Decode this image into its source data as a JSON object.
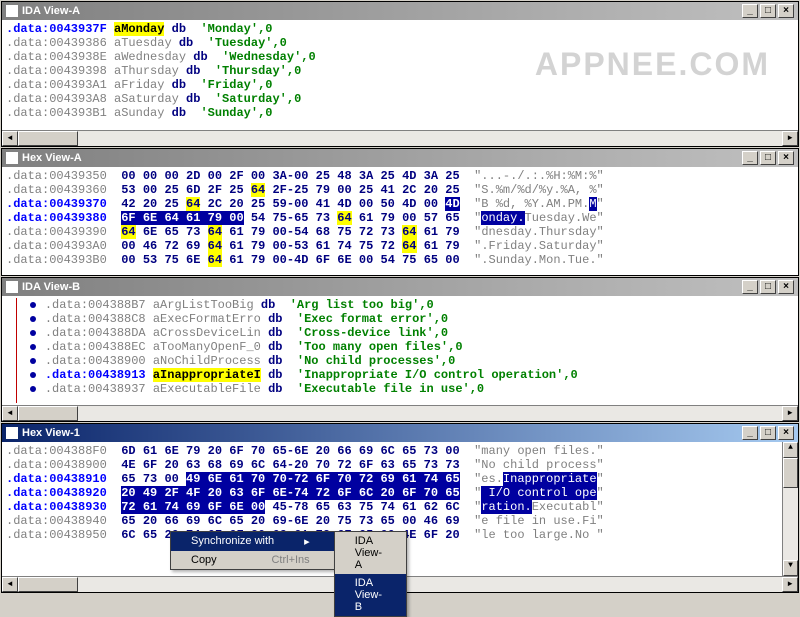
{
  "watermark": "APPNEE.COM",
  "windows": {
    "ida_a": {
      "title": "IDA View-A"
    },
    "hex_a": {
      "title": "Hex View-A"
    },
    "ida_b": {
      "title": "IDA View-B"
    },
    "hex_1": {
      "title": "Hex View-1"
    }
  },
  "ida_a_lines": [
    {
      "addr": ".data:0043937F",
      "bold": true,
      "label": "aMonday",
      "hl": true,
      "rest": " db  'Monday',0"
    },
    {
      "addr": ".data:00439386",
      "bold": false,
      "label": "aTuesday",
      "hl": false,
      "rest": " db  'Tuesday',0"
    },
    {
      "addr": ".data:0043938E",
      "bold": false,
      "label": "aWednesday",
      "hl": false,
      "rest": " db  'Wednesday',0"
    },
    {
      "addr": ".data:00439398",
      "bold": false,
      "label": "aThursday",
      "hl": false,
      "rest": " db  'Thursday',0"
    },
    {
      "addr": ".data:004393A1",
      "bold": false,
      "label": "aFriday",
      "hl": false,
      "rest": " db  'Friday',0"
    },
    {
      "addr": ".data:004393A8",
      "bold": false,
      "label": "aSaturday",
      "hl": false,
      "rest": " db  'Saturday',0"
    },
    {
      "addr": ".data:004393B1",
      "bold": false,
      "label": "aSunday",
      "hl": false,
      "rest": " db  'Sunday',0"
    }
  ],
  "hex_a_lines": [
    {
      "addr": ".data:00439350",
      "hex": "00 00 00 2D 00 2F 00 3A-00 25 48 3A 25 4D 3A 25",
      "ascii": "\"...-./.:.%H:%M:%\""
    },
    {
      "addr": ".data:00439360",
      "hex": "53 00 25 6D 2F 25 64 2F-25 79 00 25 41 2C 20 25",
      "ascii": "\"S.%m/%d/%y.%A, %\""
    },
    {
      "addr": ".data:00439370",
      "hex": "42 20 25 64 2C 20 25 59-00 41 4D 00 50 4D 00 4D",
      "ascii": "\"B %d, %Y.AM.PM.M\""
    },
    {
      "addr": ".data:00439380",
      "hex": "6F 6E 64 61 79 00 54 75-65 73 64 61 79 00 57 65",
      "ascii": "\"onday.Tuesday.We\""
    },
    {
      "addr": ".data:00439390",
      "hex": "64 6E 65 73 64 61 79 00-54 68 75 72 73 64 61 79",
      "ascii": "\"dnesday.Thursday\""
    },
    {
      "addr": ".data:004393A0",
      "hex": "00 46 72 69 64 61 79 00-53 61 74 75 72 64 61 79",
      "ascii": "\".Friday.Saturday\""
    },
    {
      "addr": ".data:004393B0",
      "hex": "00 53 75 6E 64 61 79 00-4D 6F 6E 00 54 75 65 00",
      "ascii": "\".Sunday.Mon.Tue.\""
    }
  ],
  "ida_b_lines": [
    {
      "addr": ".data:004388B7",
      "label": "aArgListTooBig",
      "rest": " db  'Arg list too big',0"
    },
    {
      "addr": ".data:004388C8",
      "label": "aExecFormatErro",
      "rest": " db  'Exec format error',0"
    },
    {
      "addr": ".data:004388DA",
      "label": "aCrossDeviceLin",
      "rest": " db  'Cross-device link',0"
    },
    {
      "addr": ".data:004388EC",
      "label": "aTooManyOpenF_0",
      "rest": " db  'Too many open files',0"
    },
    {
      "addr": ".data:00438900",
      "label": "aNoChildProcess",
      "rest": " db  'No child processes',0"
    },
    {
      "addr": ".data:00438913",
      "label": "aInappropriateI",
      "hl": true,
      "bold": true,
      "rest": " db  'Inappropriate I/O control operation',0"
    },
    {
      "addr": ".data:00438937",
      "label": "aExecutableFile",
      "rest": " db  'Executable file in use',0"
    }
  ],
  "hex_1_lines": [
    {
      "addr": ".data:004388F0",
      "hex": "6D 61 6E 79 20 6F 70 65-6E 20 66 69 6C 65 73 00",
      "ascii": "\"many open files.\""
    },
    {
      "addr": ".data:00438900",
      "hex": "4E 6F 20 63 68 69 6C 64-20 70 72 6F 63 65 73 73",
      "ascii": "\"No child process\""
    },
    {
      "addr": ".data:00438910",
      "hex": "65 73 00 49 6E 61 70 70-72 6F 70 72 69 61 74 65",
      "ascii": "\"es.Inappropriate\""
    },
    {
      "addr": ".data:00438920",
      "hex": "20 49 2F 4F 20 63 6F 6E-74 72 6F 6C 20 6F 70 65",
      "ascii": "\" I/O control ope\""
    },
    {
      "addr": ".data:00438930",
      "hex": "72 61 74 69 6F 6E 00 45-78 65 63 75 74 61 62 6C",
      "ascii": "\"ration.Executabl\""
    },
    {
      "addr": ".data:00438940",
      "hex": "65 20 66 69 6C 65 20 69-6E 20 75 73 65 00 46 69",
      "ascii": "\"e file in use.Fi\""
    },
    {
      "addr": ".data:00438950",
      "hex": "6C 65 20 74 6F 6F 20 6C-61 72 67 65 00 4E 6F 20",
      "ascii": "\"le too large.No \""
    }
  ],
  "context_menu": {
    "items": [
      {
        "label": "Synchronize with",
        "submenu": true
      },
      {
        "label": "Copy",
        "shortcut": "Ctrl+Ins"
      }
    ],
    "submenu_items": [
      {
        "label": "IDA View-A"
      },
      {
        "label": "IDA View-B",
        "hl": true
      }
    ]
  }
}
